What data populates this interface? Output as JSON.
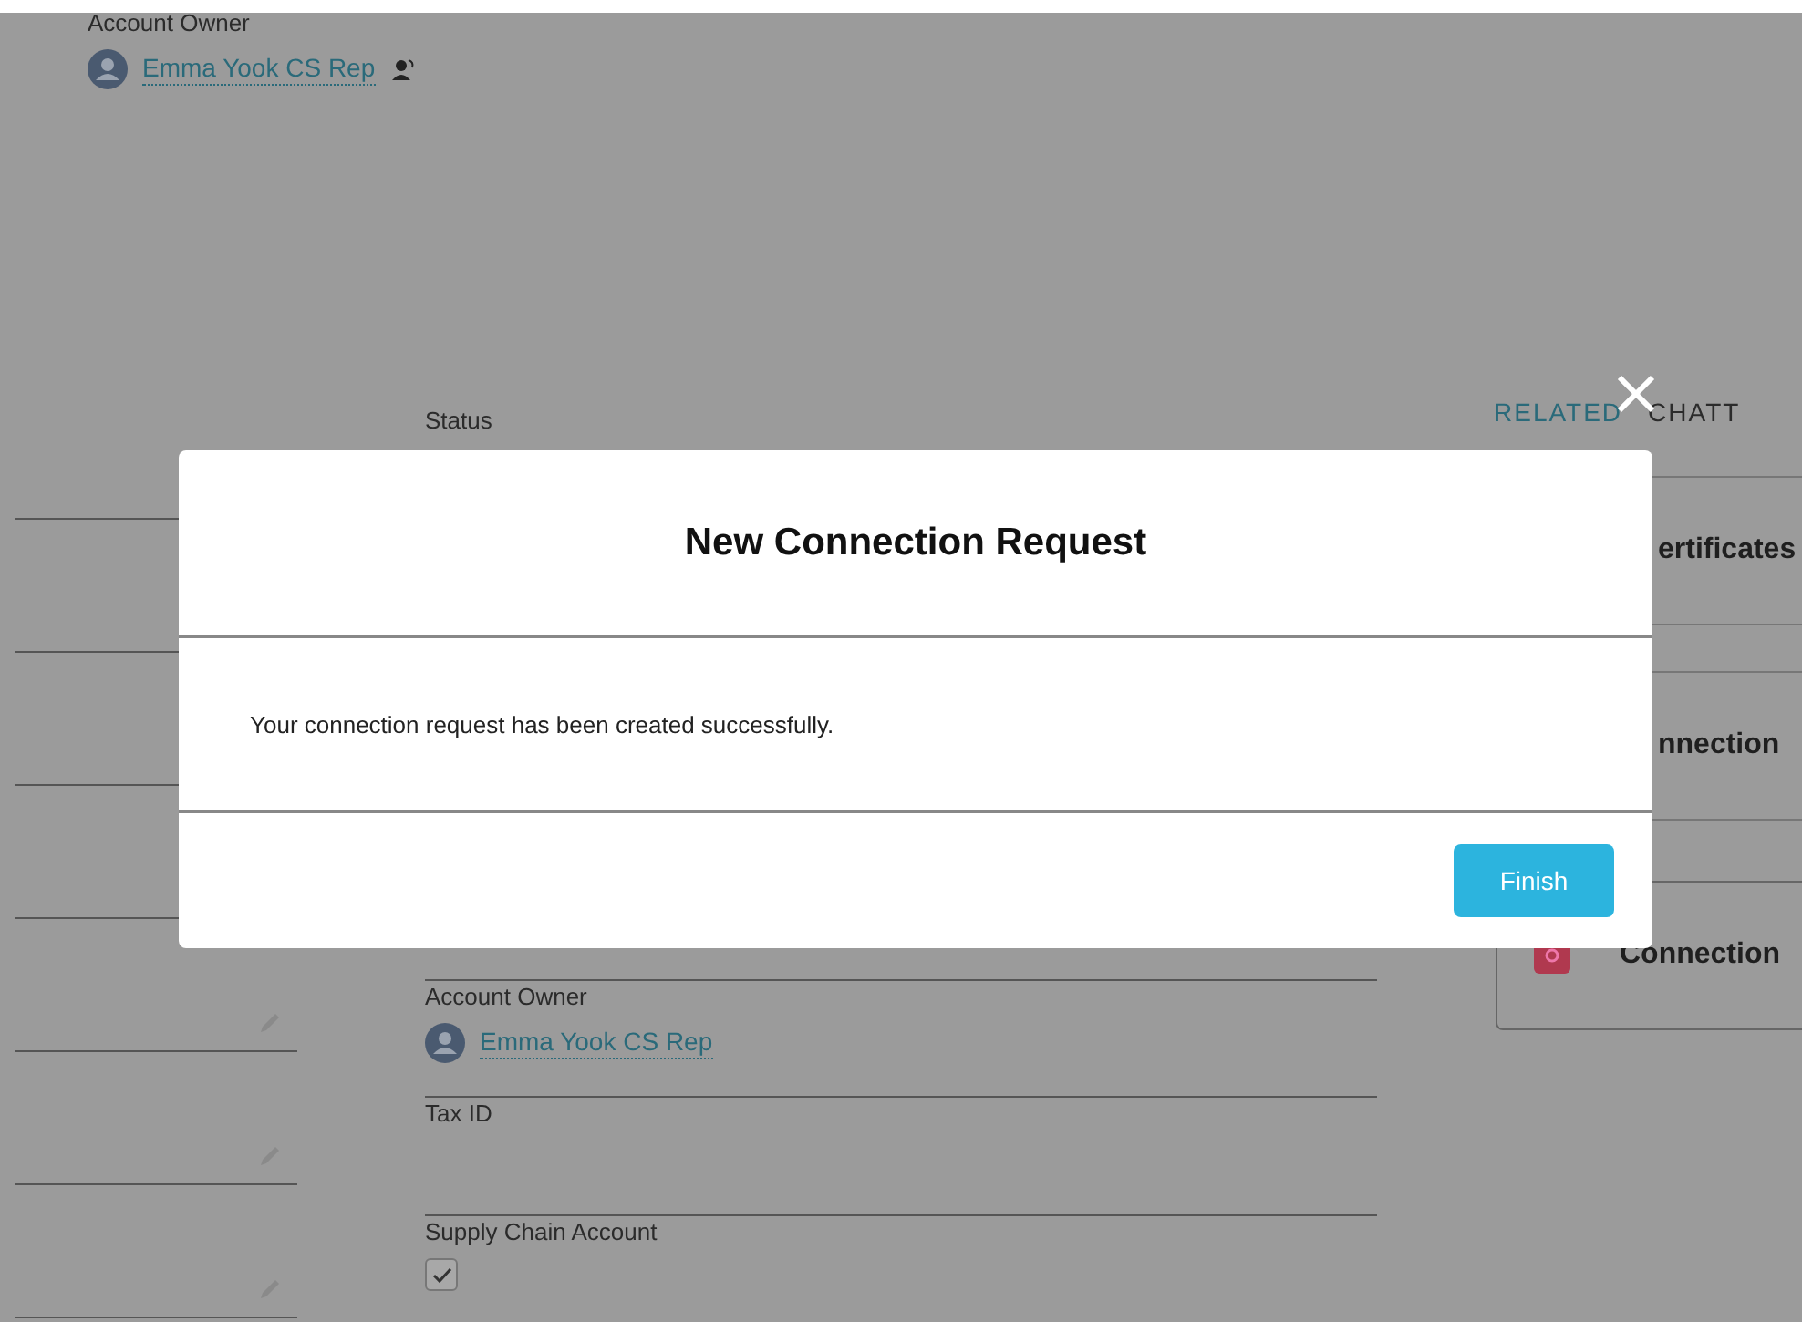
{
  "top_owner": {
    "label": "Account Owner",
    "value": "Emma Yook CS Rep"
  },
  "detail_fields": [
    {
      "kind": "text",
      "label": "Status"
    },
    {
      "kind": "user",
      "label": "Account Owner",
      "value": "Emma Yook CS Rep"
    },
    {
      "kind": "text",
      "label": "Tax ID"
    },
    {
      "kind": "checkbox",
      "label": "Supply Chain Account",
      "checked": true
    }
  ],
  "tabs": [
    {
      "label": "RELATED",
      "selected": true
    },
    {
      "label": "CHATT",
      "selected": false
    }
  ],
  "related_cards": [
    {
      "kind": "plain",
      "title": "ertificates"
    },
    {
      "kind": "plain",
      "title": "nnection"
    },
    {
      "kind": "icon",
      "title": "Connection"
    }
  ],
  "modal": {
    "title": "New Connection Request",
    "message": "Your connection request has been created successfully.",
    "button": "Finish"
  }
}
